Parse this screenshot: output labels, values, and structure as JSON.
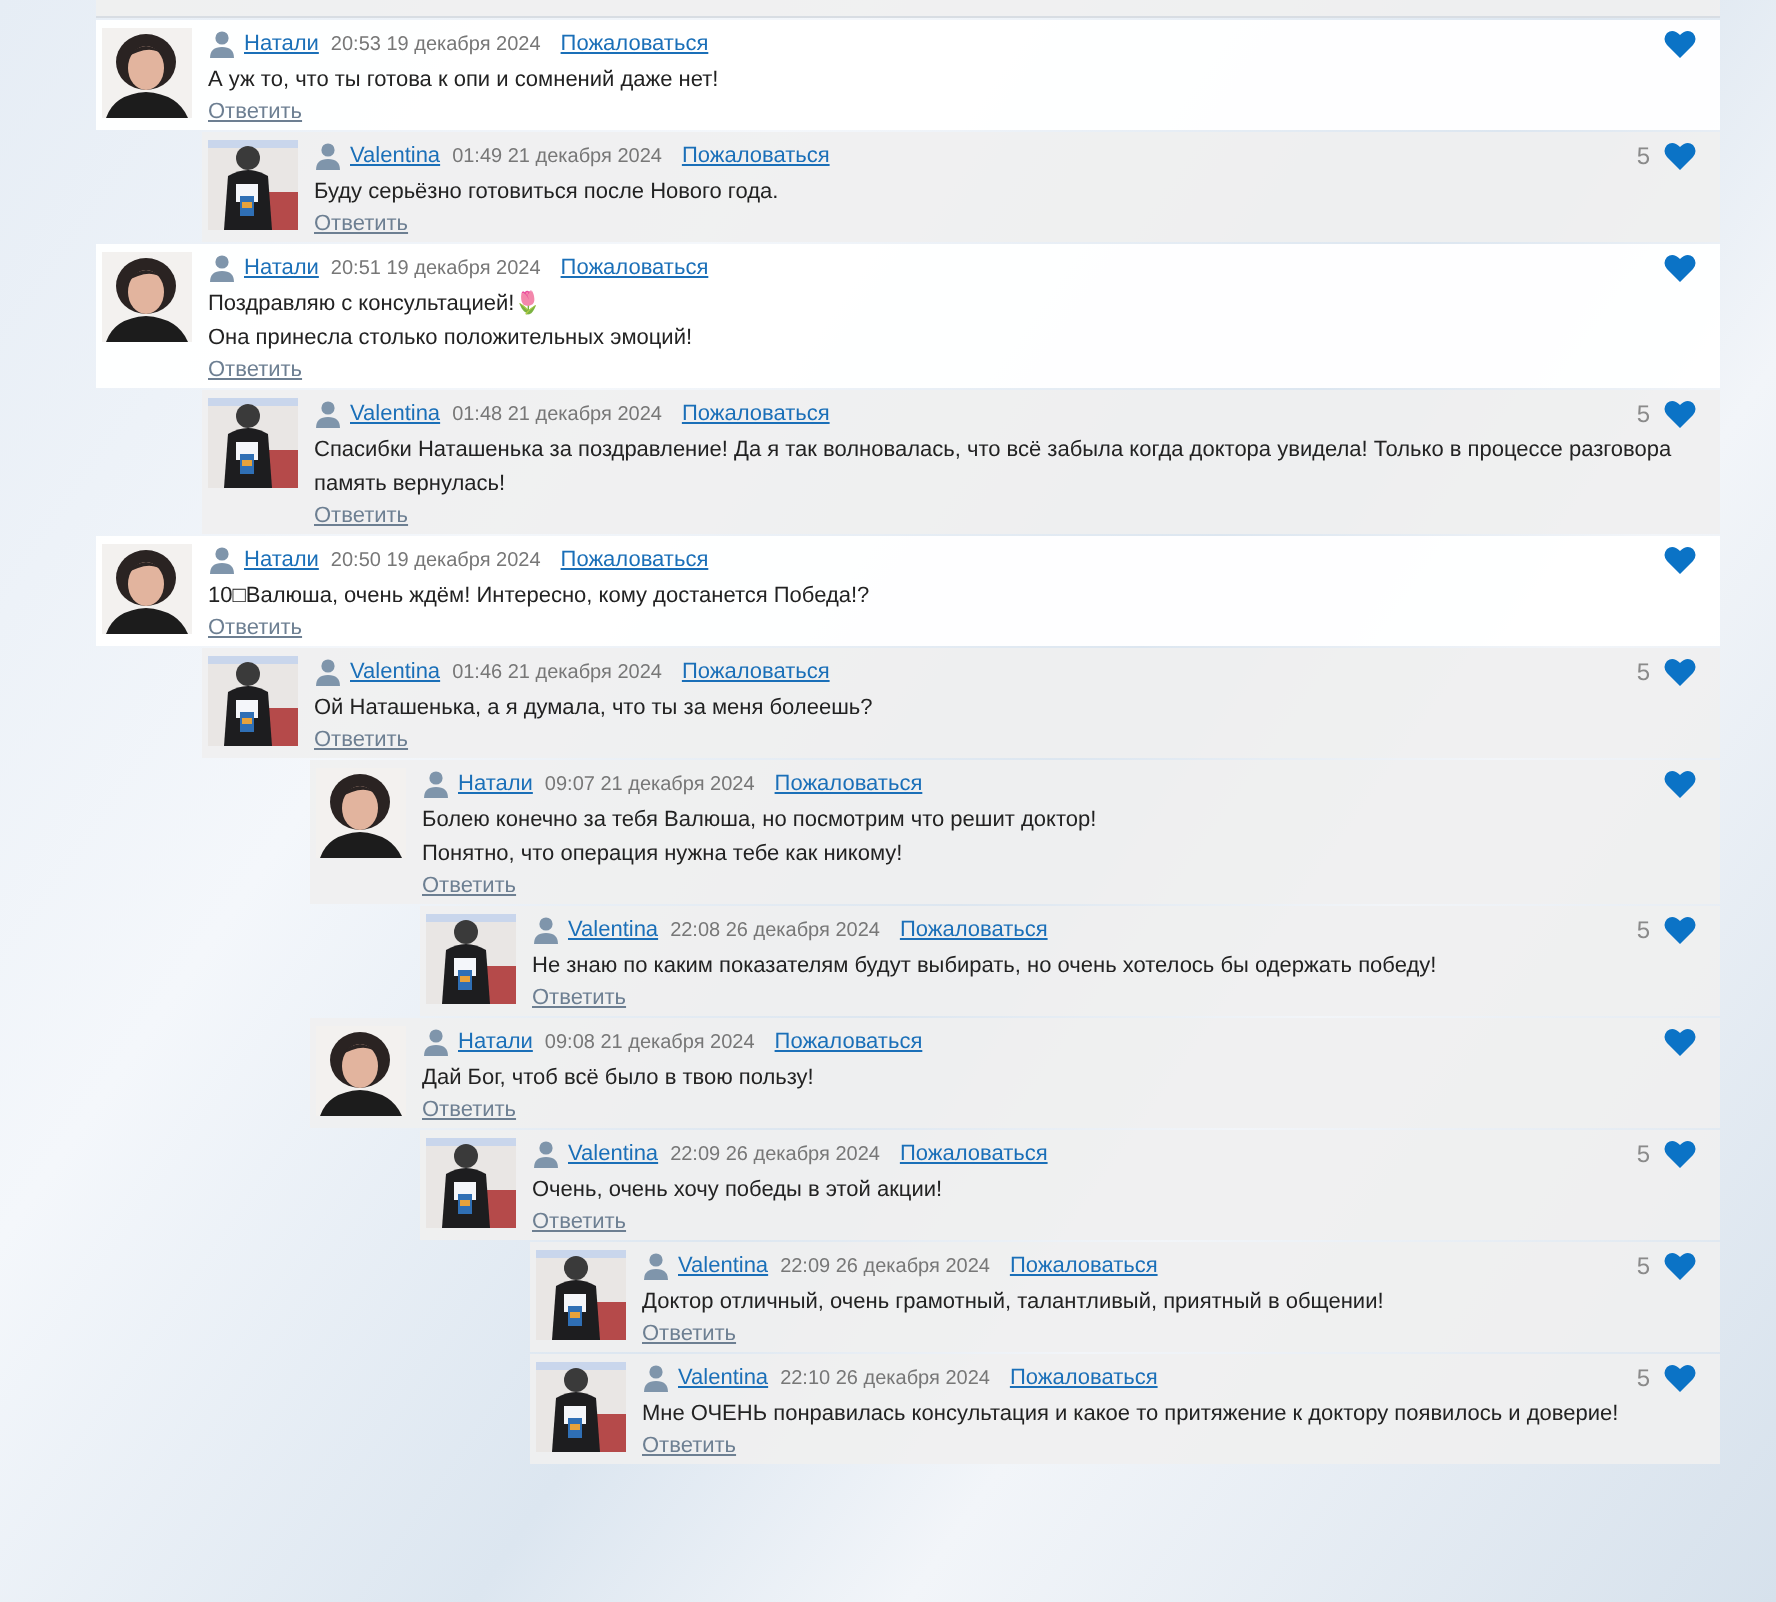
{
  "comments": [
    {
      "author": "Натали",
      "time": "20:53 19 декабря 2024",
      "report": "Пожаловаться",
      "text": "А уж то, что ты готова к опи и сомнений даже нет!",
      "reply": "Ответить",
      "children": [
        {
          "author": "Valentina",
          "time": "01:49 21 декабря 2024",
          "report": "Пожаловаться",
          "text": "Буду серьёзно готовиться после Нового года.",
          "reply": "Ответить",
          "likes": "5"
        }
      ]
    },
    {
      "author": "Натали",
      "time": "20:51 19 декабря 2024",
      "report": "Пожаловаться",
      "text": "Поздравляю с консультацией!🌷\nОна принесла столько положительных эмоций!",
      "reply": "Ответить",
      "children": [
        {
          "author": "Valentina",
          "time": "01:48 21 декабря 2024",
          "report": "Пожаловаться",
          "text": "Спасибки Наташенька за поздравление! Да я так волновалась, что всё забыла когда доктора увидела! Только в процессе разговора память вернулась!",
          "reply": "Ответить",
          "likes": "5"
        }
      ]
    },
    {
      "author": "Натали",
      "time": "20:50 19 декабря 2024",
      "report": "Пожаловаться",
      "text": "10□Валюша, очень ждём! Интересно, кому достанется Победа!?",
      "reply": "Ответить",
      "children": [
        {
          "author": "Valentina",
          "time": "01:46 21 декабря 2024",
          "report": "Пожаловаться",
          "text": "Ой Наташенька, а я думала, что ты за меня болеешь?",
          "reply": "Ответить",
          "likes": "5",
          "children": [
            {
              "author": "Натали",
              "time": "09:07 21 декабря 2024",
              "report": "Пожаловаться",
              "text": "Болею конечно за тебя Валюша, но посмотрим что решит доктор!\nПонятно, что операция нужна тебе как никому!",
              "reply": "Ответить",
              "children": [
                {
                  "author": "Valentina",
                  "time": "22:08 26 декабря 2024",
                  "report": "Пожаловаться",
                  "text": "Не знаю по каким показателям будут выбирать, но очень хотелось бы одержать победу!",
                  "reply": "Ответить",
                  "likes": "5"
                }
              ]
            },
            {
              "author": "Натали",
              "time": "09:08 21 декабря 2024",
              "report": "Пожаловаться",
              "text": "Дай Бог, чтоб всё было в твою пользу!",
              "reply": "Ответить",
              "children": [
                {
                  "author": "Valentina",
                  "time": "22:09 26 декабря 2024",
                  "report": "Пожаловаться",
                  "text": "Очень, очень хочу победы в этой акции!",
                  "reply": "Ответить",
                  "likes": "5",
                  "children": [
                    {
                      "author": "Valentina",
                      "time": "22:09 26 декабря 2024",
                      "report": "Пожаловаться",
                      "text": "Доктор отличный, очень грамотный, талантливый, приятный в общении!",
                      "reply": "Ответить",
                      "likes": "5"
                    },
                    {
                      "author": "Valentina",
                      "time": "22:10 26 декабря 2024",
                      "report": "Пожаловаться",
                      "text": "Мне ОЧЕНЬ понравилась консультация и какое то притяжение к доктору появилось и доверие!",
                      "reply": "Ответить",
                      "likes": "5"
                    }
                  ]
                }
              ]
            }
          ]
        }
      ]
    }
  ]
}
